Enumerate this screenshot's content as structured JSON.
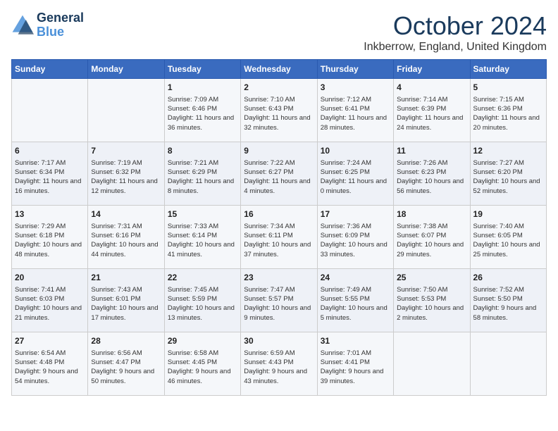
{
  "logo": {
    "line1": "General",
    "line2": "Blue"
  },
  "title": "October 2024",
  "location": "Inkberrow, England, United Kingdom",
  "days_of_week": [
    "Sunday",
    "Monday",
    "Tuesday",
    "Wednesday",
    "Thursday",
    "Friday",
    "Saturday"
  ],
  "weeks": [
    [
      {
        "day": "",
        "data": ""
      },
      {
        "day": "",
        "data": ""
      },
      {
        "day": "1",
        "sunrise": "Sunrise: 7:09 AM",
        "sunset": "Sunset: 6:46 PM",
        "daylight": "Daylight: 11 hours and 36 minutes."
      },
      {
        "day": "2",
        "sunrise": "Sunrise: 7:10 AM",
        "sunset": "Sunset: 6:43 PM",
        "daylight": "Daylight: 11 hours and 32 minutes."
      },
      {
        "day": "3",
        "sunrise": "Sunrise: 7:12 AM",
        "sunset": "Sunset: 6:41 PM",
        "daylight": "Daylight: 11 hours and 28 minutes."
      },
      {
        "day": "4",
        "sunrise": "Sunrise: 7:14 AM",
        "sunset": "Sunset: 6:39 PM",
        "daylight": "Daylight: 11 hours and 24 minutes."
      },
      {
        "day": "5",
        "sunrise": "Sunrise: 7:15 AM",
        "sunset": "Sunset: 6:36 PM",
        "daylight": "Daylight: 11 hours and 20 minutes."
      }
    ],
    [
      {
        "day": "6",
        "sunrise": "Sunrise: 7:17 AM",
        "sunset": "Sunset: 6:34 PM",
        "daylight": "Daylight: 11 hours and 16 minutes."
      },
      {
        "day": "7",
        "sunrise": "Sunrise: 7:19 AM",
        "sunset": "Sunset: 6:32 PM",
        "daylight": "Daylight: 11 hours and 12 minutes."
      },
      {
        "day": "8",
        "sunrise": "Sunrise: 7:21 AM",
        "sunset": "Sunset: 6:29 PM",
        "daylight": "Daylight: 11 hours and 8 minutes."
      },
      {
        "day": "9",
        "sunrise": "Sunrise: 7:22 AM",
        "sunset": "Sunset: 6:27 PM",
        "daylight": "Daylight: 11 hours and 4 minutes."
      },
      {
        "day": "10",
        "sunrise": "Sunrise: 7:24 AM",
        "sunset": "Sunset: 6:25 PM",
        "daylight": "Daylight: 11 hours and 0 minutes."
      },
      {
        "day": "11",
        "sunrise": "Sunrise: 7:26 AM",
        "sunset": "Sunset: 6:23 PM",
        "daylight": "Daylight: 10 hours and 56 minutes."
      },
      {
        "day": "12",
        "sunrise": "Sunrise: 7:27 AM",
        "sunset": "Sunset: 6:20 PM",
        "daylight": "Daylight: 10 hours and 52 minutes."
      }
    ],
    [
      {
        "day": "13",
        "sunrise": "Sunrise: 7:29 AM",
        "sunset": "Sunset: 6:18 PM",
        "daylight": "Daylight: 10 hours and 48 minutes."
      },
      {
        "day": "14",
        "sunrise": "Sunrise: 7:31 AM",
        "sunset": "Sunset: 6:16 PM",
        "daylight": "Daylight: 10 hours and 44 minutes."
      },
      {
        "day": "15",
        "sunrise": "Sunrise: 7:33 AM",
        "sunset": "Sunset: 6:14 PM",
        "daylight": "Daylight: 10 hours and 41 minutes."
      },
      {
        "day": "16",
        "sunrise": "Sunrise: 7:34 AM",
        "sunset": "Sunset: 6:11 PM",
        "daylight": "Daylight: 10 hours and 37 minutes."
      },
      {
        "day": "17",
        "sunrise": "Sunrise: 7:36 AM",
        "sunset": "Sunset: 6:09 PM",
        "daylight": "Daylight: 10 hours and 33 minutes."
      },
      {
        "day": "18",
        "sunrise": "Sunrise: 7:38 AM",
        "sunset": "Sunset: 6:07 PM",
        "daylight": "Daylight: 10 hours and 29 minutes."
      },
      {
        "day": "19",
        "sunrise": "Sunrise: 7:40 AM",
        "sunset": "Sunset: 6:05 PM",
        "daylight": "Daylight: 10 hours and 25 minutes."
      }
    ],
    [
      {
        "day": "20",
        "sunrise": "Sunrise: 7:41 AM",
        "sunset": "Sunset: 6:03 PM",
        "daylight": "Daylight: 10 hours and 21 minutes."
      },
      {
        "day": "21",
        "sunrise": "Sunrise: 7:43 AM",
        "sunset": "Sunset: 6:01 PM",
        "daylight": "Daylight: 10 hours and 17 minutes."
      },
      {
        "day": "22",
        "sunrise": "Sunrise: 7:45 AM",
        "sunset": "Sunset: 5:59 PM",
        "daylight": "Daylight: 10 hours and 13 minutes."
      },
      {
        "day": "23",
        "sunrise": "Sunrise: 7:47 AM",
        "sunset": "Sunset: 5:57 PM",
        "daylight": "Daylight: 10 hours and 9 minutes."
      },
      {
        "day": "24",
        "sunrise": "Sunrise: 7:49 AM",
        "sunset": "Sunset: 5:55 PM",
        "daylight": "Daylight: 10 hours and 5 minutes."
      },
      {
        "day": "25",
        "sunrise": "Sunrise: 7:50 AM",
        "sunset": "Sunset: 5:53 PM",
        "daylight": "Daylight: 10 hours and 2 minutes."
      },
      {
        "day": "26",
        "sunrise": "Sunrise: 7:52 AM",
        "sunset": "Sunset: 5:50 PM",
        "daylight": "Daylight: 9 hours and 58 minutes."
      }
    ],
    [
      {
        "day": "27",
        "sunrise": "Sunrise: 6:54 AM",
        "sunset": "Sunset: 4:48 PM",
        "daylight": "Daylight: 9 hours and 54 minutes."
      },
      {
        "day": "28",
        "sunrise": "Sunrise: 6:56 AM",
        "sunset": "Sunset: 4:47 PM",
        "daylight": "Daylight: 9 hours and 50 minutes."
      },
      {
        "day": "29",
        "sunrise": "Sunrise: 6:58 AM",
        "sunset": "Sunset: 4:45 PM",
        "daylight": "Daylight: 9 hours and 46 minutes."
      },
      {
        "day": "30",
        "sunrise": "Sunrise: 6:59 AM",
        "sunset": "Sunset: 4:43 PM",
        "daylight": "Daylight: 9 hours and 43 minutes."
      },
      {
        "day": "31",
        "sunrise": "Sunrise: 7:01 AM",
        "sunset": "Sunset: 4:41 PM",
        "daylight": "Daylight: 9 hours and 39 minutes."
      },
      {
        "day": "",
        "data": ""
      },
      {
        "day": "",
        "data": ""
      }
    ]
  ]
}
